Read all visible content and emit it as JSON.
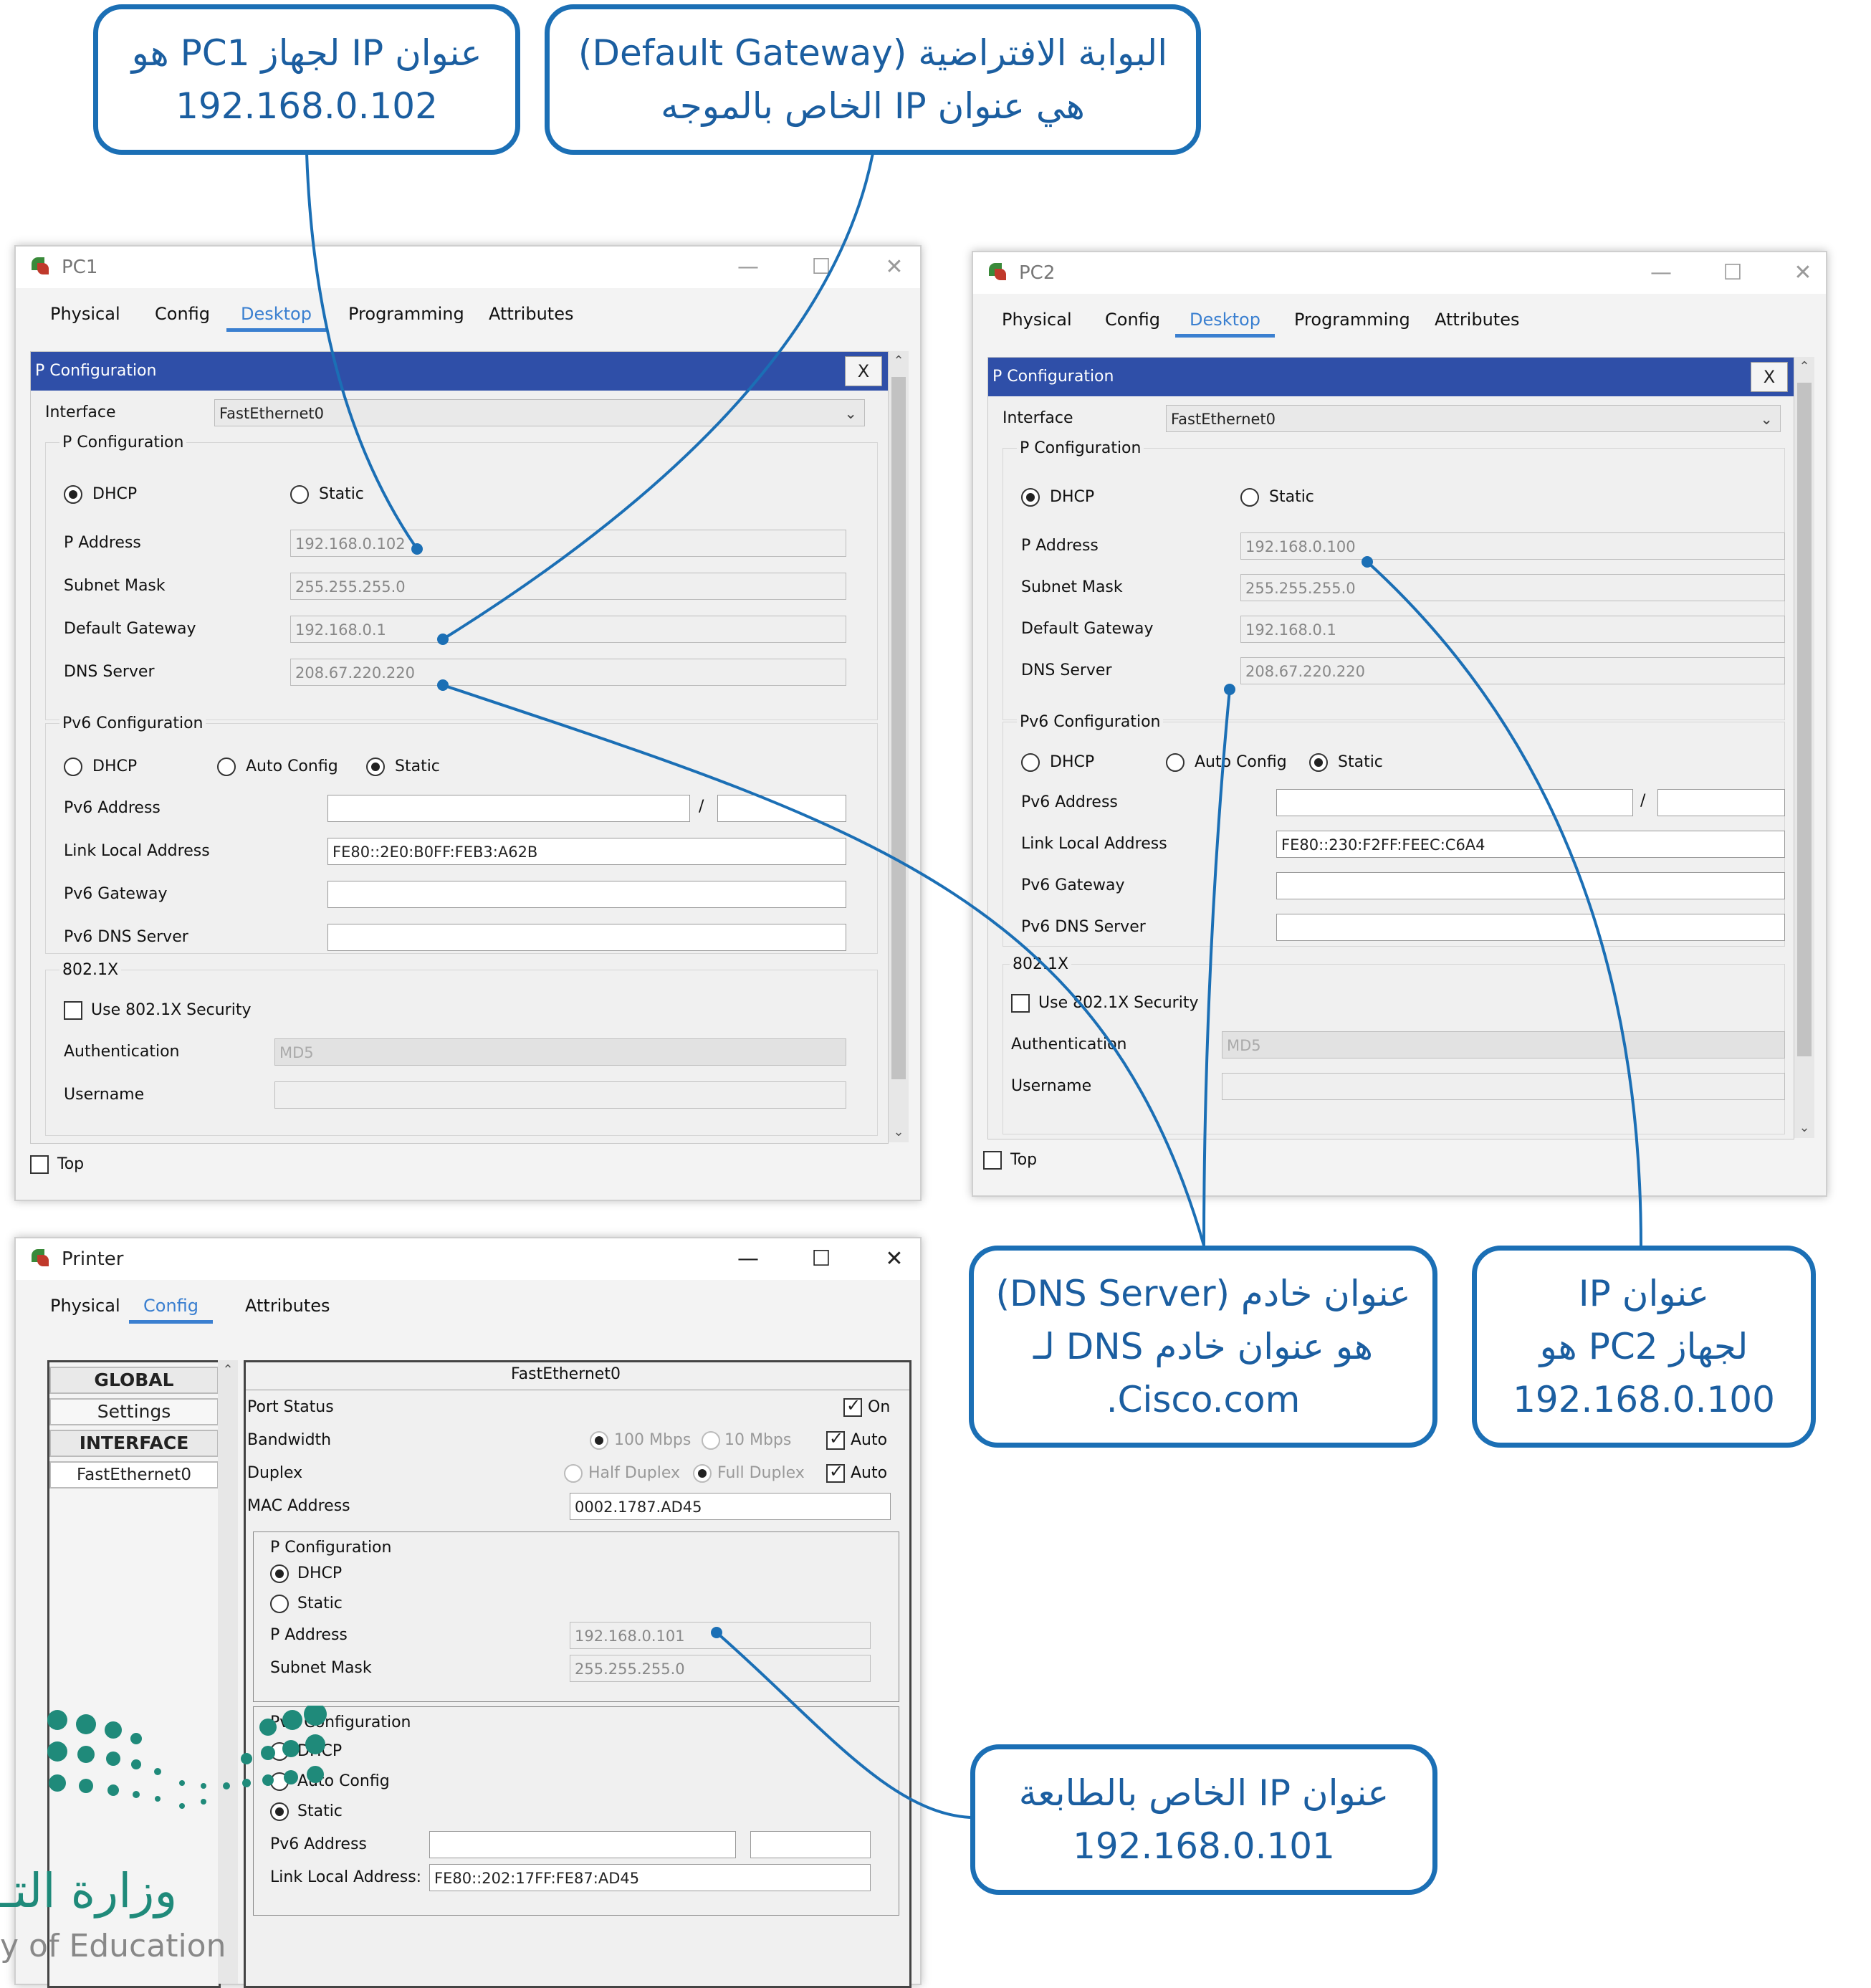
{
  "callouts": {
    "pc1_ip": [
      "عنوان IP لجهاز PC1 هو",
      "192.168.0.102"
    ],
    "gateway": [
      "البوابة الافتراضية (Default Gateway)",
      "هي عنوان IP الخاص بالموجه"
    ],
    "dns": [
      "عنوان خادم (DNS Server)",
      "هو عنوان خادم DNS لـ",
      ".Cisco.com"
    ],
    "pc2_ip": [
      "عنوان IP",
      "لجهاز PC2 هو",
      "192.168.0.100"
    ],
    "printer_ip": [
      "عنوان IP الخاص بالطابعة",
      "192.168.0.101"
    ]
  },
  "window_controls": {
    "minimize": "—",
    "maximize": "☐",
    "close": "✕"
  },
  "tabs_pc": [
    "Physical",
    "Config",
    "Desktop",
    "Programming",
    "Attributes"
  ],
  "tabs_printer": [
    "Physical",
    "Config",
    "Attributes"
  ],
  "ipconfig_labels": {
    "title": "P Configuration",
    "close": "X",
    "interface": "Interface",
    "ip_group": "P Configuration",
    "dhcp": "DHCP",
    "static": "Static",
    "ip_address": "P Address",
    "subnet": "Subnet Mask",
    "gateway": "Default Gateway",
    "dns": "DNS Server",
    "ipv6_group": "Pv6 Configuration",
    "auto_config": "Auto Config",
    "ipv6_address": "Pv6 Address",
    "link_local": "Link Local Address",
    "ipv6_gateway": "Pv6 Gateway",
    "ipv6_dns": "Pv6 DNS Server",
    "dot1x": "802.1X",
    "use_dot1x": "Use 802.1X Security",
    "authentication": "Authentication",
    "username": "Username",
    "top": "Top",
    "slash": "/"
  },
  "pc1": {
    "title": "PC1",
    "interface": "FastEthernet0",
    "ip": "192.168.0.102",
    "subnet": "255.255.255.0",
    "gateway": "192.168.0.1",
    "dns": "208.67.220.220",
    "link_local": "FE80::2E0:B0FF:FEB3:A62B",
    "auth": "MD5"
  },
  "pc2": {
    "title": "PC2",
    "interface": "FastEthernet0",
    "ip": "192.168.0.100",
    "subnet": "255.255.255.0",
    "gateway": "192.168.0.1",
    "dns": "208.67.220.220",
    "link_local": "FE80::230:F2FF:FEEC:C6A4",
    "auth": "MD5"
  },
  "printer": {
    "title": "Printer",
    "sidebar": [
      "GLOBAL",
      "Settings",
      "INTERFACE",
      "FastEthernet0"
    ],
    "header": "FastEthernet0",
    "port_status": "Port Status",
    "on": "On",
    "bandwidth": "Bandwidth",
    "bw100": "100 Mbps",
    "bw10": "10 Mbps",
    "auto": "Auto",
    "duplex": "Duplex",
    "half": "Half Duplex",
    "full": "Full Duplex",
    "mac_label": "MAC Address",
    "mac": "0002.1787.AD45",
    "ip_group": "P Configuration",
    "dhcp": "DHCP",
    "static": "Static",
    "ip_label": "P Address",
    "ip": "192.168.0.101",
    "subnet_label": "Subnet Mask",
    "subnet": "255.255.255.0",
    "ipv6_group": "Pv6 Configuration",
    "auto_config": "Auto Config",
    "ipv6_label": "Pv6 Address",
    "link_local_label": "Link Local Address:",
    "link_local": "FE80::202:17FF:FE87:AD45"
  },
  "logo": {
    "text": "وزارة التـ",
    "sub": "y of Education"
  },
  "colors": {
    "callout_border": "#1b6fb5",
    "callout_text": "#1b5ea0",
    "ip_bar": "#2f4fa8",
    "active_tab": "#3a7fd0",
    "logo": "#1f8a7a"
  }
}
